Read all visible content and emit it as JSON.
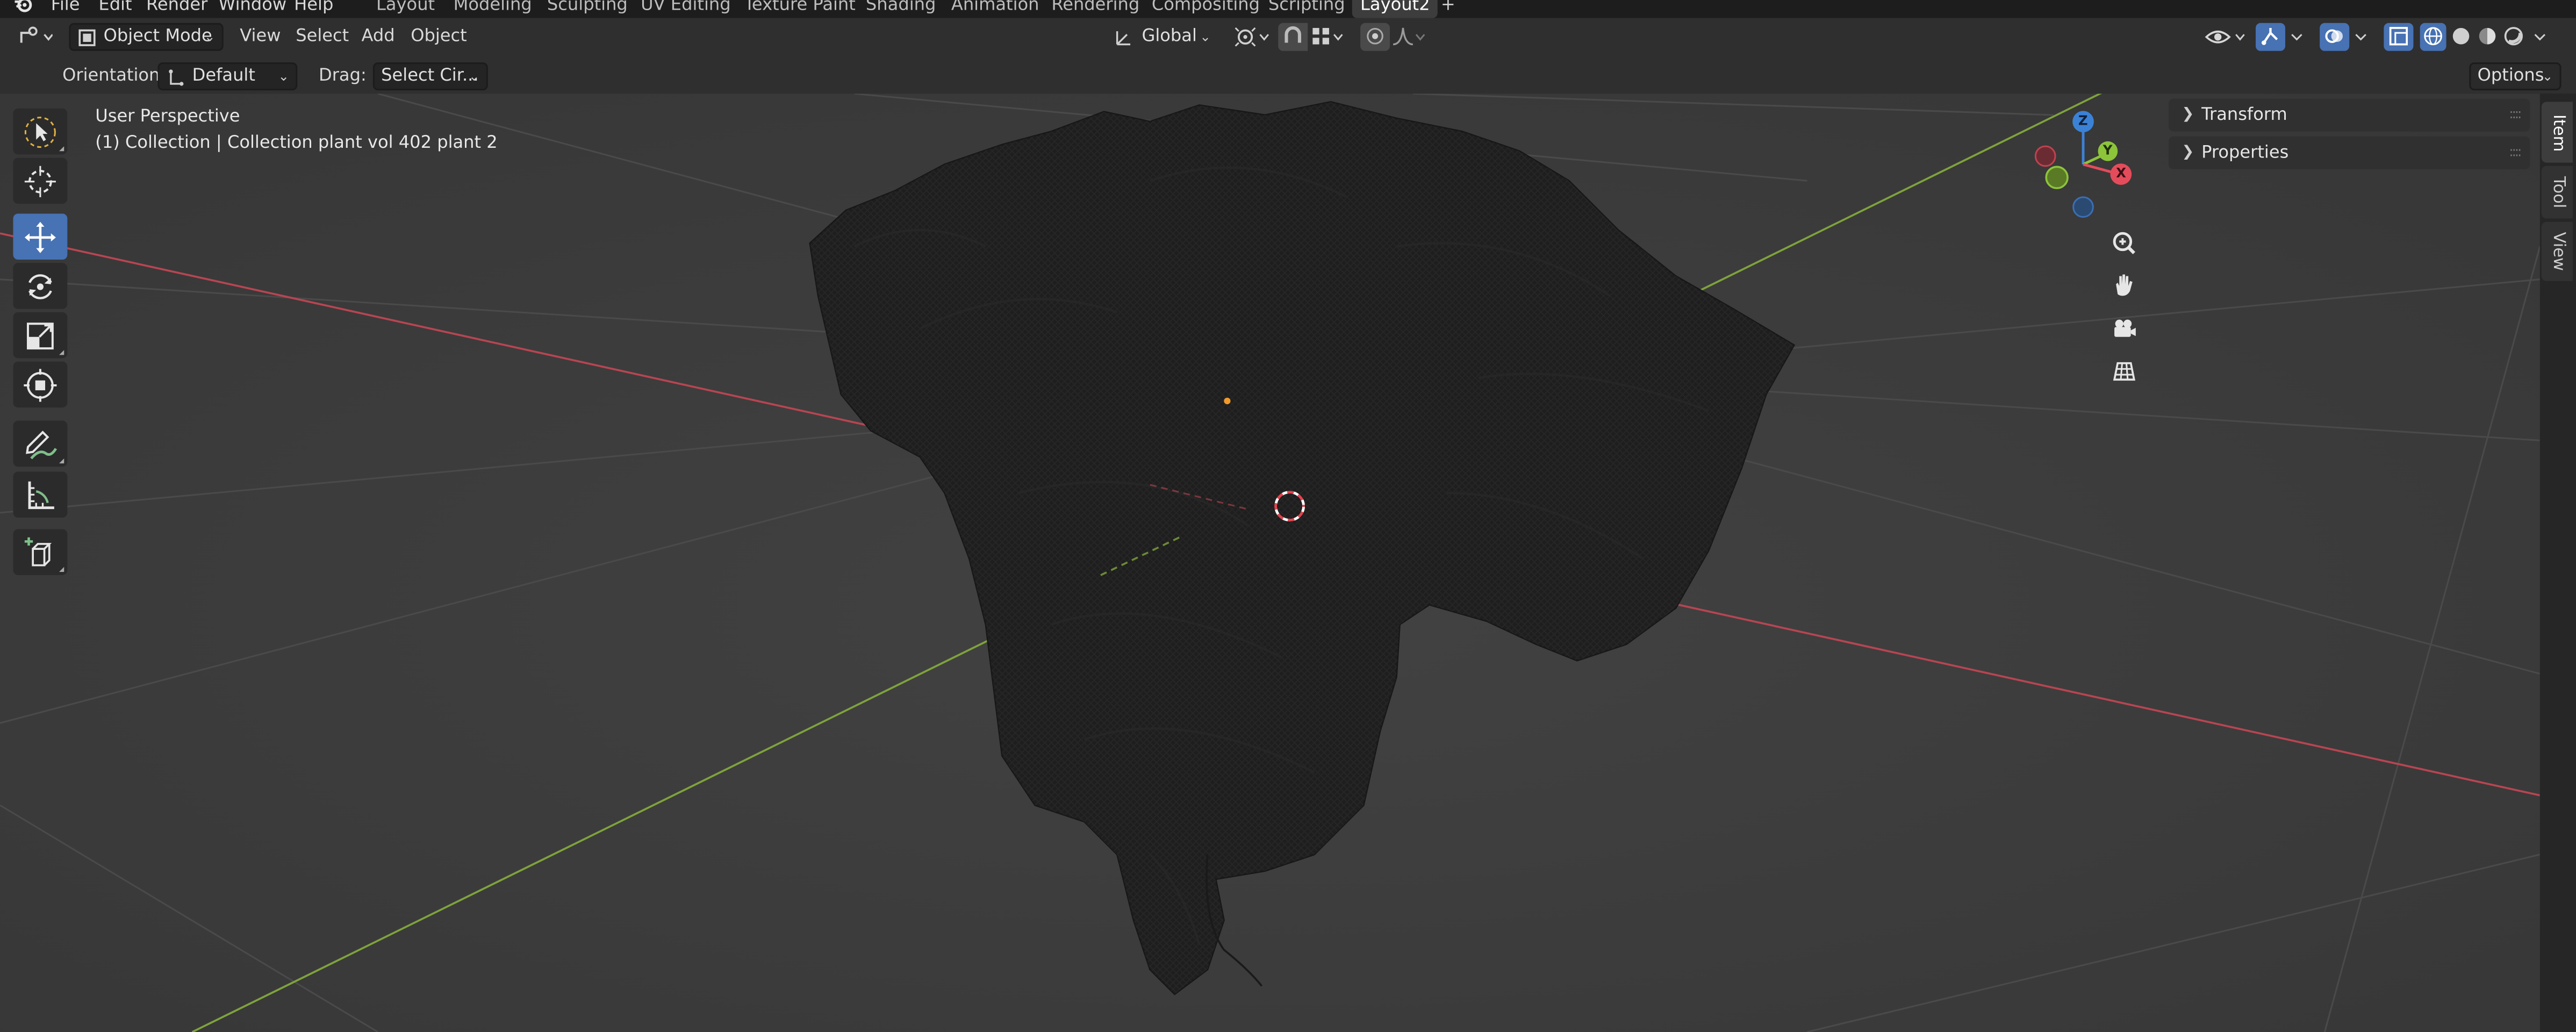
{
  "menu": {
    "file": "File",
    "edit": "Edit",
    "render": "Render",
    "window": "Window",
    "help": "Help"
  },
  "workspace_tabs": [
    {
      "label": "Layout"
    },
    {
      "label": "Modeling"
    },
    {
      "label": "Sculpting"
    },
    {
      "label": "UV Editing"
    },
    {
      "label": "Texture Paint"
    },
    {
      "label": "Shading"
    },
    {
      "label": "Animation"
    },
    {
      "label": "Rendering"
    },
    {
      "label": "Compositing"
    },
    {
      "label": "Scripting"
    },
    {
      "label": "Layout2",
      "active": true
    }
  ],
  "add_workspace": "+",
  "header": {
    "mode": "Object Mode",
    "view": "View",
    "select": "Select",
    "add": "Add",
    "object": "Object",
    "transform_orientation": "Global",
    "options": "Options"
  },
  "tool_settings": {
    "orientation_label": "Orientation:",
    "orientation_value": "Default",
    "drag_label": "Drag:",
    "drag_value": "Select Cir..."
  },
  "viewport": {
    "perspective": "User Perspective",
    "collection_info": "(1) Collection | Collection plant vol 402 plant 2"
  },
  "gizmo": {
    "x": "X",
    "y": "Y",
    "z": "Z"
  },
  "npanel": {
    "transform": "Transform",
    "properties": "Properties"
  },
  "sidebar_tabs": {
    "item": "Item",
    "tool": "Tool",
    "view": "View"
  },
  "colors": {
    "accent": "#4772b3",
    "axis_x": "#e44c5b",
    "axis_y": "#8cc43a",
    "axis_z": "#3b82d6"
  }
}
